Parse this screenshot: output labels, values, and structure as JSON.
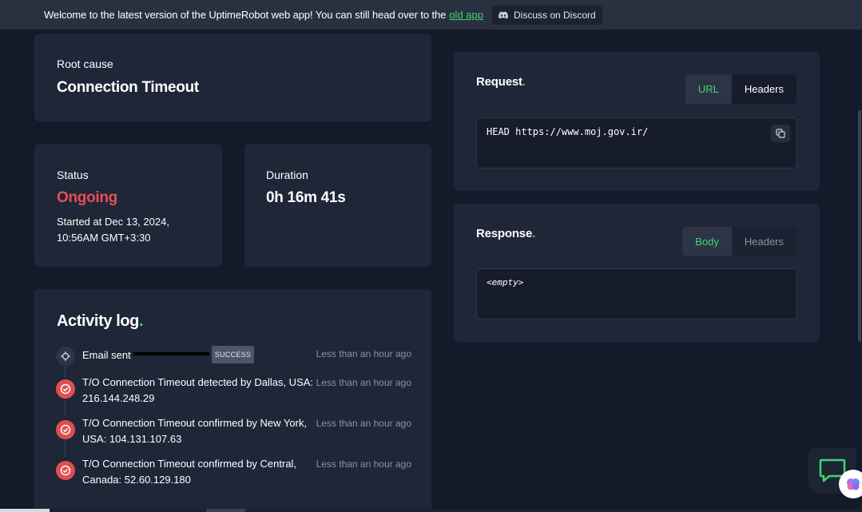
{
  "banner": {
    "message": "Welcome to the latest version of the UptimeRobot web app! You can still head over to the",
    "old_app_link": "old app",
    "discord_label": "Discuss on Discord"
  },
  "root_cause": {
    "label": "Root cause",
    "value": "Connection Timeout"
  },
  "status": {
    "label": "Status",
    "value": "Ongoing",
    "started_line1": "Started at Dec 13, 2024,",
    "started_line2": "10:56AM GMT+3:30"
  },
  "duration": {
    "label": "Duration",
    "value": "0h 16m 41s"
  },
  "activity_log": {
    "title": "Activity log",
    "title_dot": ".",
    "items": [
      {
        "text": "Email sent",
        "badge": "SUCCESS",
        "time": "Less than an hour ago",
        "icon": "envelope-icon"
      },
      {
        "line1": "T/O Connection Timeout detected by Dallas, USA:",
        "line2": "216.144.248.29",
        "time": "Less than an hour ago",
        "icon": "down-alert-icon"
      },
      {
        "line1": "T/O Connection Timeout confirmed by New York,",
        "line2": "USA: 104.131.107.63",
        "time": "Less than an hour ago",
        "icon": "down-alert-icon"
      },
      {
        "line1": "T/O Connection Timeout confirmed by Central,",
        "line2": "Canada: 52.60.129.180",
        "time": "Less than an hour ago",
        "icon": "down-alert-icon"
      }
    ]
  },
  "request": {
    "title": "Request",
    "title_dot": ".",
    "tabs": [
      "URL",
      "Headers"
    ],
    "active_tab": "URL",
    "content": "HEAD https://www.moj.gov.ir/"
  },
  "response": {
    "title": "Response",
    "title_dot": ".",
    "tabs": [
      "Body",
      "Headers"
    ],
    "active_tab": "Body",
    "content": "<empty>"
  },
  "colors": {
    "background": "#131a2a",
    "card": "#1f2637",
    "accent_green": "#3bd671",
    "danger_red": "#e84f51",
    "muted_text": "#8a93a3"
  }
}
